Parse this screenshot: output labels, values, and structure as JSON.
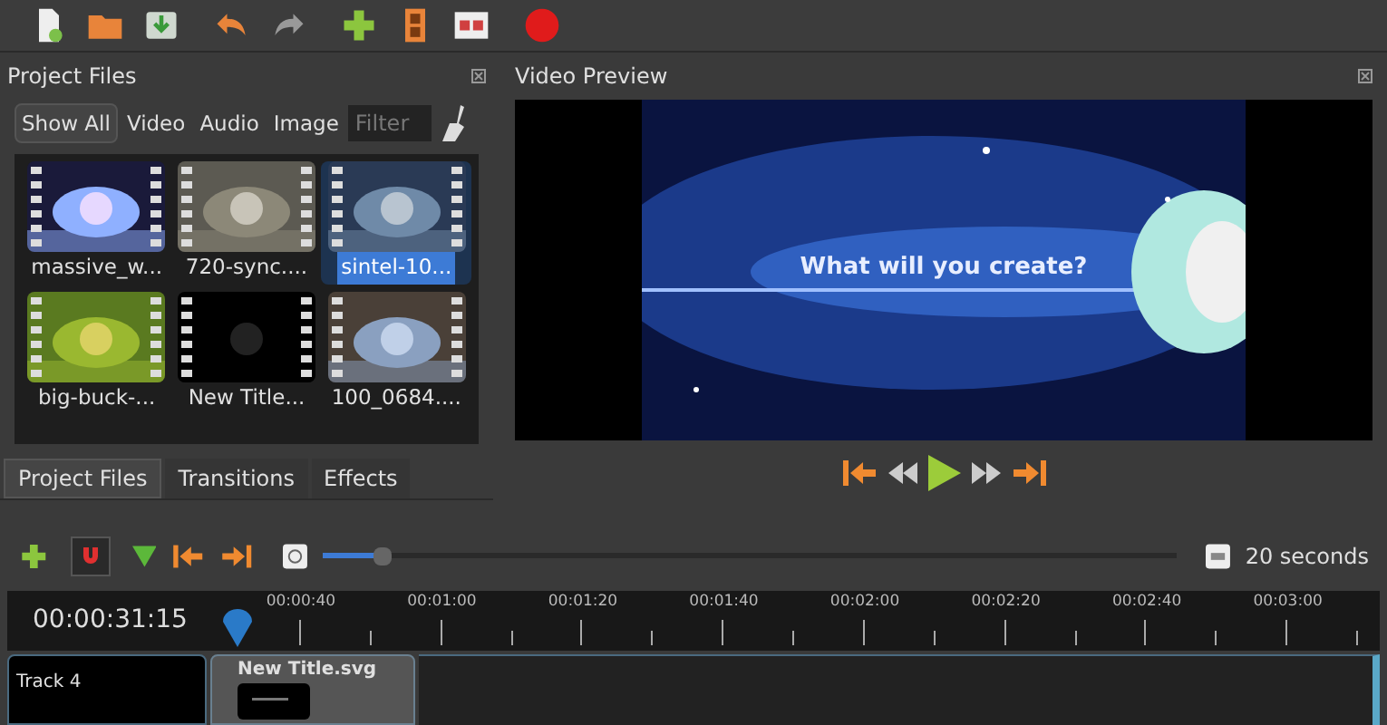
{
  "project_files": {
    "title": "Project Files",
    "filters": [
      {
        "label": "Show All",
        "selected": true
      },
      {
        "label": "Video",
        "selected": false
      },
      {
        "label": "Audio",
        "selected": false
      },
      {
        "label": "Image",
        "selected": false
      }
    ],
    "search": {
      "placeholder": "Filter"
    },
    "files": [
      {
        "name": "massive_w...",
        "selected": false
      },
      {
        "name": "720-sync....",
        "selected": false
      },
      {
        "name": "sintel-10...",
        "selected": true
      },
      {
        "name": "big-buck-...",
        "selected": false
      },
      {
        "name": "New Title...",
        "selected": false
      },
      {
        "name": "100_0684....",
        "selected": false
      }
    ]
  },
  "bottom_tabs": [
    {
      "label": "Project Files",
      "selected": true
    },
    {
      "label": "Transitions",
      "selected": false
    },
    {
      "label": "Effects",
      "selected": false
    }
  ],
  "preview": {
    "title": "Video Preview",
    "overlay_text": "What will you create?"
  },
  "timeline": {
    "zoom": {
      "level": 0.07
    },
    "zoom_label": "20 seconds",
    "time": "00:00:31:15",
    "ruler": [
      "00:00:40",
      "00:01:00",
      "00:01:20",
      "00:01:40",
      "00:02:00",
      "00:02:20",
      "00:02:40",
      "00:03:00"
    ],
    "tracks": [
      {
        "name": "Track 4",
        "clips": [
          {
            "name": "New Title.svg"
          }
        ]
      }
    ]
  }
}
